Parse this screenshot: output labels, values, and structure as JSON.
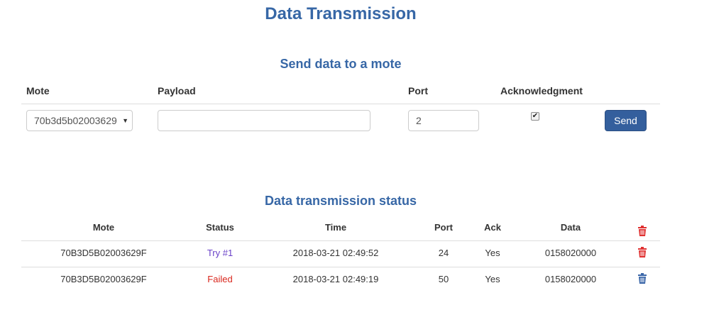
{
  "page": {
    "title": "Data Transmission"
  },
  "send_form": {
    "title": "Send data to a mote",
    "headers": {
      "mote": "Mote",
      "payload": "Payload",
      "port": "Port",
      "ack": "Acknowledgment"
    },
    "mote_selected": "70b3d5b02003629",
    "payload_value": "",
    "port_value": "2",
    "ack_checked": true,
    "send_label": "Send"
  },
  "status_table": {
    "title": "Data transmission status",
    "columns": {
      "mote": "Mote",
      "status": "Status",
      "time": "Time",
      "port": "Port",
      "ack": "Ack",
      "data": "Data"
    },
    "rows": [
      {
        "mote": "70B3D5B02003629F",
        "status": "Try #1",
        "time": "2018-03-21 02:49:52",
        "port": "24",
        "ack": "Yes",
        "data": "0158020000",
        "delete_icon": "trash-red-icon"
      },
      {
        "mote": "70B3D5B02003629F",
        "status": "Failed",
        "time": "2018-03-21 02:49:19",
        "port": "50",
        "ack": "Yes",
        "data": "0158020000",
        "delete_icon": "trash-blue-icon"
      }
    ]
  },
  "colors": {
    "title": "#3767a6",
    "button": "#345f9d",
    "status_try": "#6a42c8",
    "status_failed": "#d9261c",
    "trash_red": "#e03131",
    "trash_blue": "#3a66a8"
  }
}
